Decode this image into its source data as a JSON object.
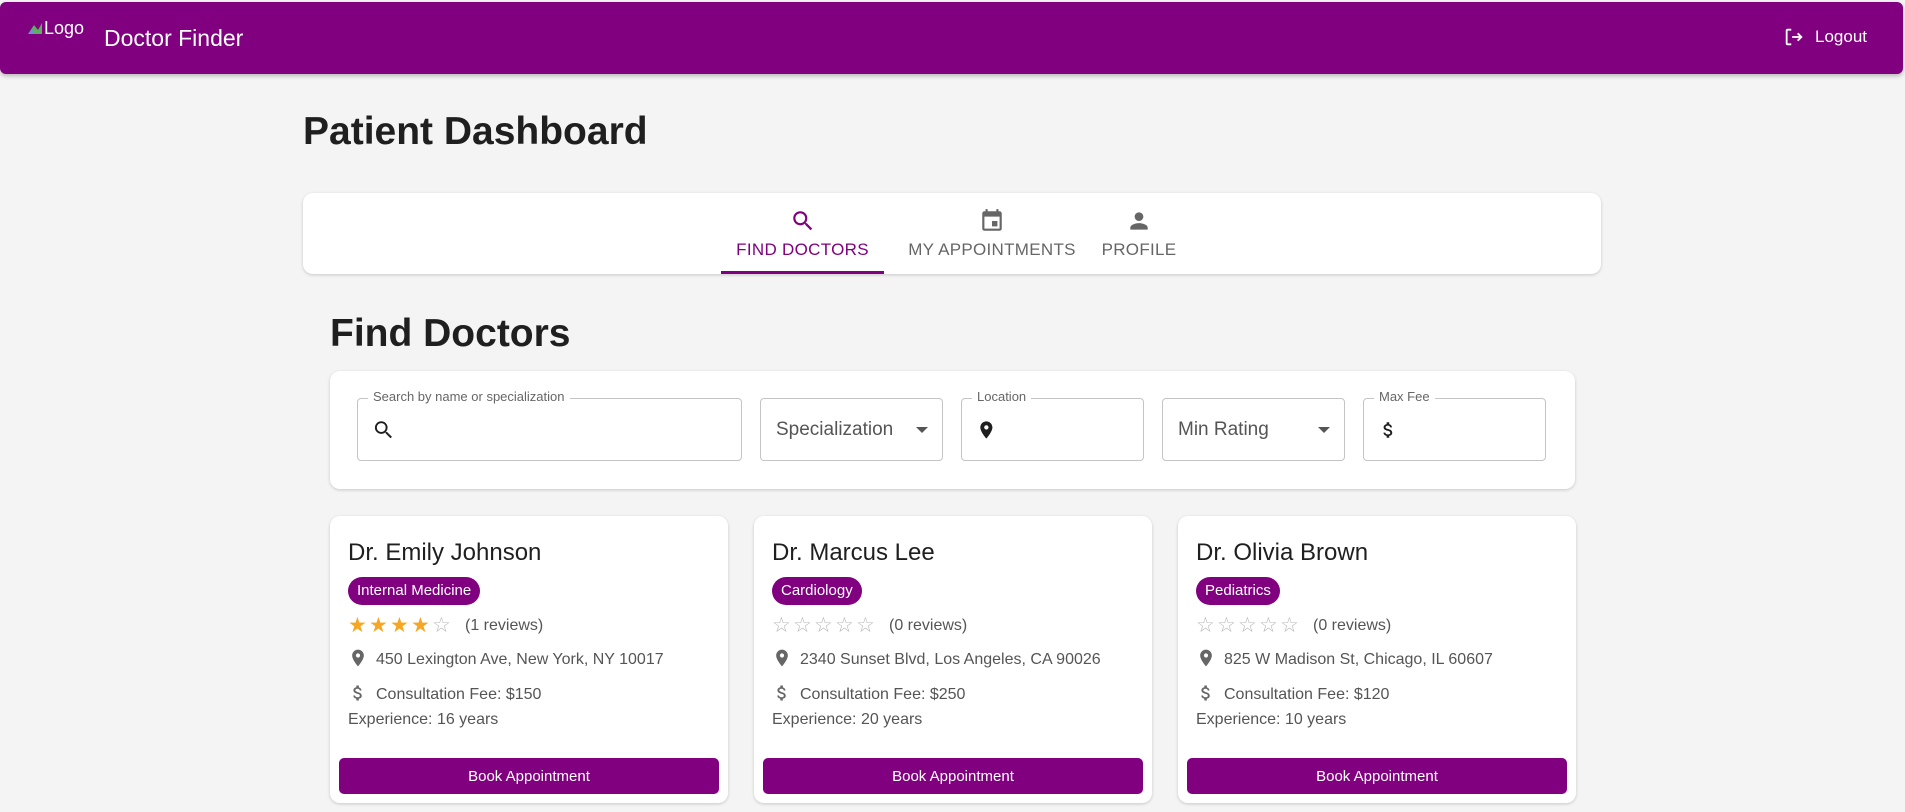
{
  "appbar": {
    "logo_alt": "Logo",
    "title": "Doctor Finder",
    "logout_label": "Logout"
  },
  "page_title": "Patient Dashboard",
  "tabs": [
    {
      "label": "FIND DOCTORS",
      "icon": "search-icon",
      "active": true
    },
    {
      "label": "MY APPOINTMENTS",
      "icon": "calendar-icon",
      "active": false
    },
    {
      "label": "PROFILE",
      "icon": "person-icon",
      "active": false
    }
  ],
  "section_title": "Find Doctors",
  "filters": {
    "search": {
      "label": "Search by name or specialization",
      "value": "",
      "icon": "search-icon"
    },
    "specialization": {
      "value": "Specialization"
    },
    "location": {
      "label": "Location",
      "value": "",
      "icon": "location-pin-icon"
    },
    "min_rating": {
      "value": "Min Rating"
    },
    "max_fee": {
      "label": "Max Fee",
      "value": "",
      "icon": "dollar-icon"
    }
  },
  "doctors": [
    {
      "name": "Dr. Emily Johnson",
      "specialization": "Internal Medicine",
      "rating": 4,
      "reviews": "(1 reviews)",
      "address": "450 Lexington Ave, New York, NY 10017",
      "fee": "Consultation Fee: $150",
      "experience": "Experience: 16 years",
      "button_label": "Book Appointment"
    },
    {
      "name": "Dr. Marcus Lee",
      "specialization": "Cardiology",
      "rating": 0,
      "reviews": "(0 reviews)",
      "address": "2340 Sunset Blvd, Los Angeles, CA 90026",
      "fee": "Consultation Fee: $250",
      "experience": "Experience: 20 years",
      "button_label": "Book Appointment"
    },
    {
      "name": "Dr. Olivia Brown",
      "specialization": "Pediatrics",
      "rating": 0,
      "reviews": "(0 reviews)",
      "address": "825 W Madison St, Chicago, IL 60607",
      "fee": "Consultation Fee: $120",
      "experience": "Experience: 10 years",
      "button_label": "Book Appointment"
    }
  ],
  "colors": {
    "primary": "#800080",
    "star": "#f5a623",
    "background": "#f4f4f4"
  }
}
